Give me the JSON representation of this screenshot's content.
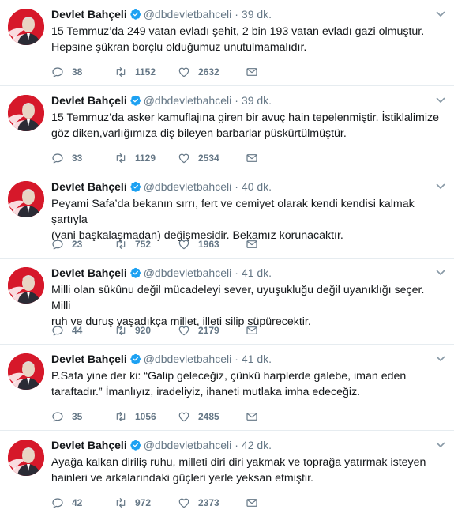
{
  "tweets": [
    {
      "name": "Devlet Bahçeli",
      "handle": "@dbdevletbahceli",
      "separator": "·",
      "time": "39 dk.",
      "text": "15 Temmuz’da 249 vatan evladı şehit, 2 bin 193 vatan evladı gazi olmuştur.\nHepsine şükran borçlu olduğumuz unutulmamalıdır.",
      "replies": "38",
      "retweets": "1152",
      "likes": "2632"
    },
    {
      "name": "Devlet Bahçeli",
      "handle": "@dbdevletbahceli",
      "separator": "·",
      "time": "39 dk.",
      "text": "15 Temmuz’da asker kamuflajına giren bir avuç hain tepelenmiştir. İstiklalimize\ngöz diken,varlığımıza diş bileyen barbarlar püskürtülmüştür.",
      "replies": "33",
      "retweets": "1129",
      "likes": "2534"
    },
    {
      "name": "Devlet Bahçeli",
      "handle": "@dbdevletbahceli",
      "separator": "·",
      "time": "40 dk.",
      "text": "Peyami Safa’da bekanın sırrı, fert ve cemiyet olarak kendi kendisi kalmak şartıyla\n(yani başkalaşmadan) değişmesidir. Bekamız korunacaktır.",
      "replies": "23",
      "retweets": "752",
      "likes": "1963"
    },
    {
      "name": "Devlet Bahçeli",
      "handle": "@dbdevletbahceli",
      "separator": "·",
      "time": "41 dk.",
      "text": "Milli olan sükûnu değil mücadeleyi sever, uyuşukluğu değil uyanıklığı seçer. Milli\nruh ve duruş yaşadıkça millet, illeti silip süpürecektir.",
      "replies": "44",
      "retweets": "920",
      "likes": "2179"
    },
    {
      "name": "Devlet Bahçeli",
      "handle": "@dbdevletbahceli",
      "separator": "·",
      "time": "41 dk.",
      "text": "P.Safa yine der ki: “Galip geleceğiz, çünkü harplerde galebe, iman eden\ntaraftadır.” İmanlıyız, iradeliyiz, ihaneti mutlaka imha edeceğiz.",
      "replies": "35",
      "retweets": "1056",
      "likes": "2485"
    },
    {
      "name": "Devlet Bahçeli",
      "handle": "@dbdevletbahceli",
      "separator": "·",
      "time": "42 dk.",
      "text": "Ayağa kalkan diriliş ruhu, milleti diri diri yakmak ve toprağa yatırmak isteyen\nhainleri ve arkalarındaki güçleri yerle yeksan etmiştir.",
      "replies": "42",
      "retweets": "972",
      "likes": "2373"
    }
  ],
  "icons": {
    "avatar": "profile-photo",
    "verified": "verified-badge-icon",
    "caret": "chevron-down-icon",
    "reply": "reply-icon",
    "retweet": "retweet-icon",
    "like": "heart-icon",
    "message": "envelope-icon"
  },
  "colors": {
    "text": "#14171a",
    "secondary": "#657786",
    "verified": "#1da1f2",
    "avatar_background": "#d6182a",
    "divider": "#e6ecf0"
  }
}
